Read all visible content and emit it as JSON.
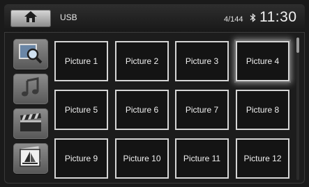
{
  "header": {
    "source_label": "USB",
    "track_counter": "4/144",
    "time": "11:30",
    "home_icon": "home-icon",
    "bluetooth_icon": "bluetooth-icon"
  },
  "sidebar": {
    "items": [
      {
        "name": "photo-search",
        "icon": "photo-search-icon"
      },
      {
        "name": "music",
        "icon": "music-note-icon"
      },
      {
        "name": "video",
        "icon": "film-clapper-icon"
      },
      {
        "name": "pictures",
        "icon": "picture-sailboat-icon"
      }
    ]
  },
  "grid": {
    "selected_index": 3,
    "tiles": [
      "Picture 1",
      "Picture 2",
      "Picture 3",
      "Picture 4",
      "Picture 5",
      "Picture 6",
      "Picture 7",
      "Picture 8",
      "Picture 9",
      "Picture 10",
      "Picture 11",
      "Picture 12"
    ]
  },
  "scrollbar": {
    "position_fraction": 0.0
  },
  "colors": {
    "background": "#1c1c1c",
    "tile_border": "#d6d6d6",
    "text": "#f0f0f0"
  }
}
